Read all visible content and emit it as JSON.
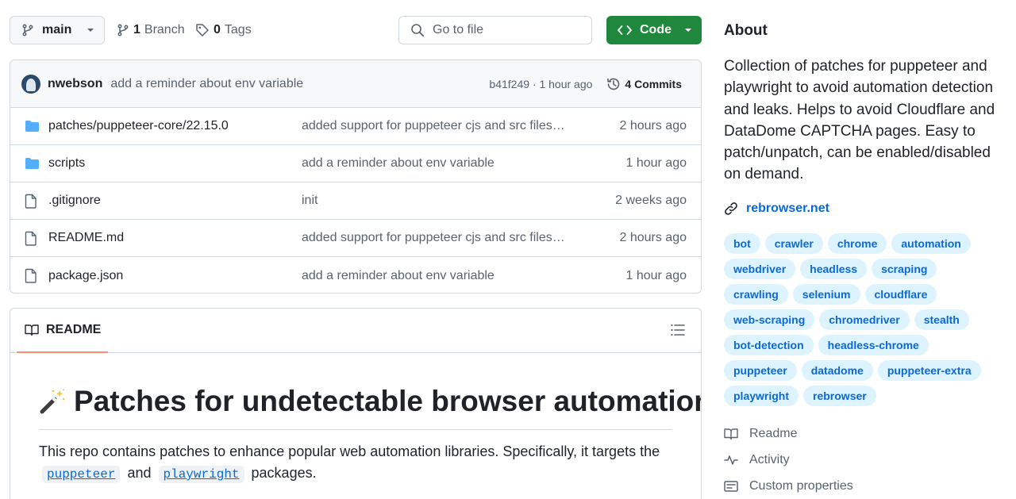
{
  "toolbar": {
    "branch_label": "main",
    "branches_count": "1",
    "branches_label": "Branch",
    "tags_count": "0",
    "tags_label": "Tags",
    "gofile_placeholder": "Go to file",
    "code_label": "Code"
  },
  "commit": {
    "author": "nwebson",
    "message": "add a reminder about env variable",
    "hash_time": "b41f249 · 1 hour ago",
    "commits_label": "4 Commits"
  },
  "files": [
    {
      "name": "patches/puppeteer-core/22.15.0",
      "type": "folder",
      "message": "added support for puppeteer cjs and src files…",
      "date": "2 hours ago"
    },
    {
      "name": "scripts",
      "type": "folder",
      "message": "add a reminder about env variable",
      "date": "1 hour ago"
    },
    {
      "name": ".gitignore",
      "type": "file",
      "message": "init",
      "date": "2 weeks ago"
    },
    {
      "name": "README.md",
      "type": "file",
      "message": "added support for puppeteer cjs and src files…",
      "date": "2 hours ago"
    },
    {
      "name": "package.json",
      "type": "file",
      "message": "add a reminder about env variable",
      "date": "1 hour ago"
    }
  ],
  "readme": {
    "tab_label": "README",
    "title": "Patches for undetectable browser automation",
    "text_1": "This repo contains patches to enhance popular web automation libraries. Specifically, it targets the",
    "code_1": "puppeteer",
    "text_2": "and",
    "code_2": "playwright",
    "text_3": "packages."
  },
  "about": {
    "heading": "About",
    "description": "Collection of patches for puppeteer and playwright to avoid automation detection and leaks. Helps to avoid Cloudflare and DataDome CAPTCHA pages. Easy to patch/unpatch, can be enabled/disabled on demand.",
    "website": "rebrowser.net",
    "topics": [
      "bot",
      "crawler",
      "chrome",
      "automation",
      "webdriver",
      "headless",
      "scraping",
      "crawling",
      "selenium",
      "cloudflare",
      "web-scraping",
      "chromedriver",
      "stealth",
      "bot-detection",
      "headless-chrome",
      "puppeteer",
      "datadome",
      "puppeteer-extra",
      "playwright",
      "rebrowser"
    ],
    "readme_link": "Readme",
    "activity_link": "Activity",
    "custom_properties_link": "Custom properties"
  },
  "colors": {
    "accent": "#0969da",
    "code_button": "#1f883d",
    "topic_bg": "#ddf4ff",
    "tab_underline": "#fd8c73",
    "folder": "#54aeff"
  },
  "icons": {
    "branch": "git-branch-icon",
    "tag": "tag-icon",
    "search": "search-icon",
    "code": "code-icon",
    "history": "history-icon",
    "folder": "folder-icon",
    "file": "file-icon",
    "book": "book-icon",
    "toc": "list-unordered-icon",
    "wand": "magic-wand-icon",
    "link": "link-icon",
    "pulse": "pulse-icon",
    "note": "note-icon"
  }
}
